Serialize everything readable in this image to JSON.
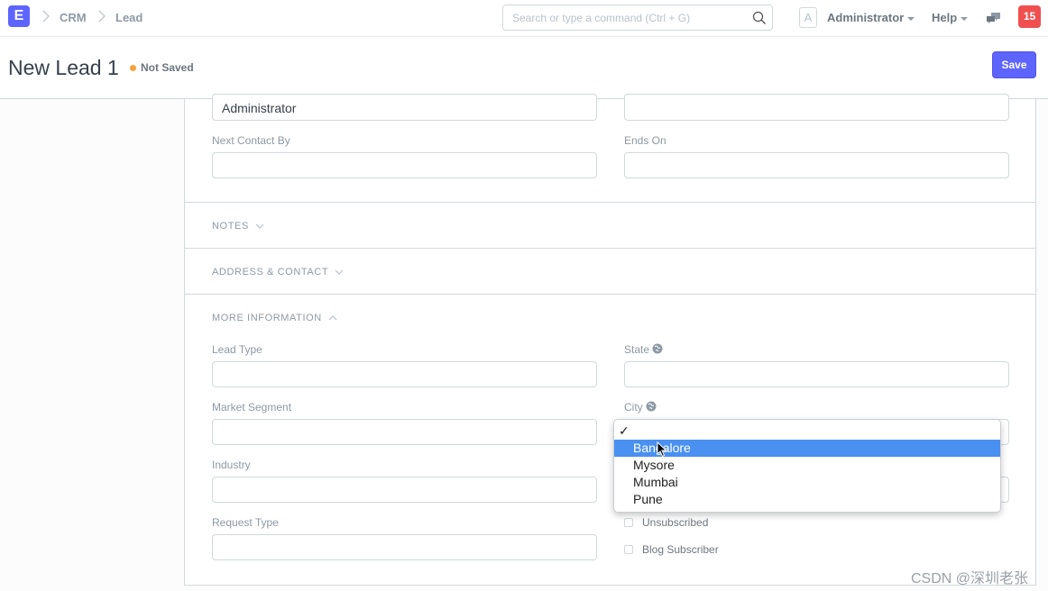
{
  "navbar": {
    "logo_letter": "E",
    "breadcrumbs": [
      "CRM",
      "Lead"
    ],
    "search_placeholder": "Search or type a command (Ctrl + G)",
    "avatar_letter": "A",
    "user_menu": "Administrator",
    "help_menu": "Help",
    "notification_count": "15"
  },
  "page": {
    "title": "New Lead 1",
    "status": "Not Saved",
    "save_label": "Save"
  },
  "form": {
    "top_left_value": "Administrator",
    "top_right_value": "",
    "next_contact_by_label": "Next Contact By",
    "ends_on_label": "Ends On",
    "sections": {
      "notes": "NOTES",
      "address_contact": "ADDRESS & CONTACT",
      "more_information": "MORE INFORMATION"
    },
    "lead_type_label": "Lead Type",
    "market_segment_label": "Market Segment",
    "industry_label": "Industry",
    "request_type_label": "Request Type",
    "state_label": "State",
    "city_label": "City",
    "unsubscribed_label": "Unsubscribed",
    "blog_subscriber_label": "Blog Subscriber"
  },
  "city_dropdown": {
    "options": [
      "",
      "Bangalore",
      "Mysore",
      "Mumbai",
      "Pune"
    ],
    "checked_index": 0,
    "highlighted": "Bangalore"
  },
  "watermark": "CSDN @深圳老张"
}
